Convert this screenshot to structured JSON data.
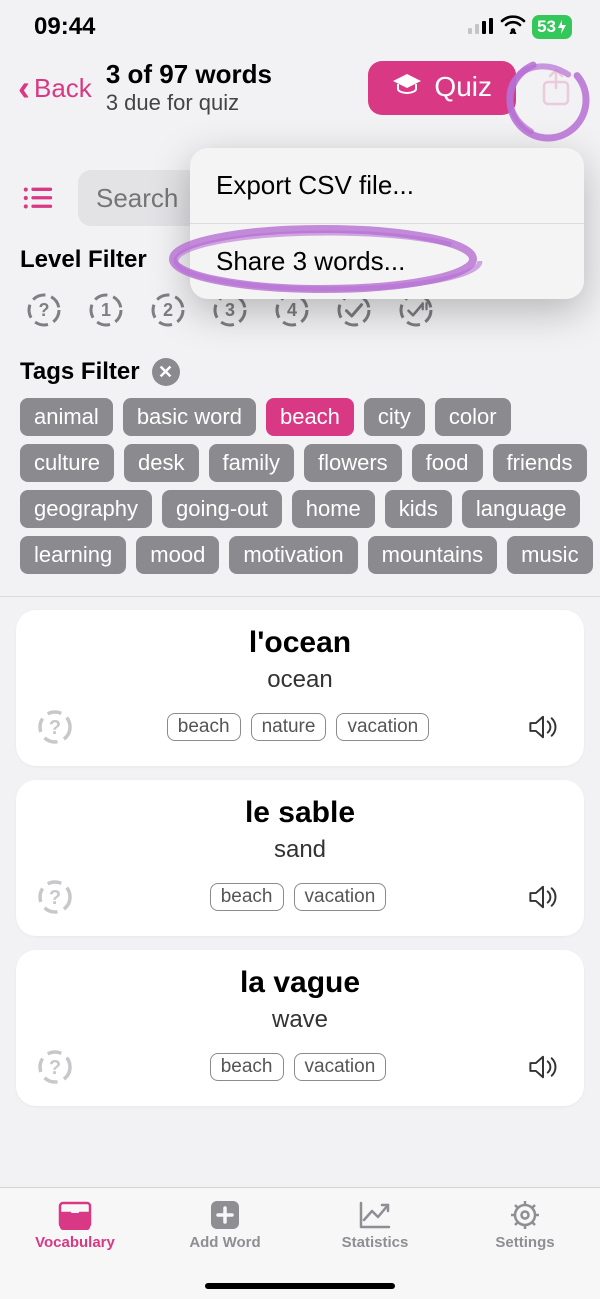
{
  "status": {
    "time": "09:44",
    "battery": "53"
  },
  "nav": {
    "back_label": "Back",
    "title": "3 of 97 words",
    "subtitle": "3 due for quiz",
    "quiz_label": "Quiz"
  },
  "search": {
    "placeholder": "Search"
  },
  "level_filter": {
    "label": "Level Filter",
    "items": [
      "?",
      "1",
      "2",
      "3",
      "4",
      "check",
      "pause"
    ]
  },
  "tags_filter": {
    "label": "Tags Filter",
    "rows": [
      [
        {
          "t": "animal"
        },
        {
          "t": "basic word"
        },
        {
          "t": "beach",
          "active": true
        },
        {
          "t": "city"
        },
        {
          "t": "color"
        }
      ],
      [
        {
          "t": "culture"
        },
        {
          "t": "desk"
        },
        {
          "t": "family"
        },
        {
          "t": "flowers"
        },
        {
          "t": "food"
        },
        {
          "t": "friends"
        }
      ],
      [
        {
          "t": "geography"
        },
        {
          "t": "going-out"
        },
        {
          "t": "home"
        },
        {
          "t": "kids"
        },
        {
          "t": "language"
        }
      ],
      [
        {
          "t": "learning"
        },
        {
          "t": "mood"
        },
        {
          "t": "motivation"
        },
        {
          "t": "mountains"
        },
        {
          "t": "music"
        }
      ]
    ]
  },
  "words": [
    {
      "word": "l'ocean",
      "trans": "ocean",
      "tags": [
        "beach",
        "nature",
        "vacation"
      ]
    },
    {
      "word": "le sable",
      "trans": "sand",
      "tags": [
        "beach",
        "vacation"
      ]
    },
    {
      "word": "la vague",
      "trans": "wave",
      "tags": [
        "beach",
        "vacation"
      ]
    }
  ],
  "popover": {
    "export": "Export CSV file...",
    "share": "Share 3 words..."
  },
  "tabs": {
    "vocabulary": "Vocabulary",
    "add_word": "Add Word",
    "statistics": "Statistics",
    "settings": "Settings"
  }
}
